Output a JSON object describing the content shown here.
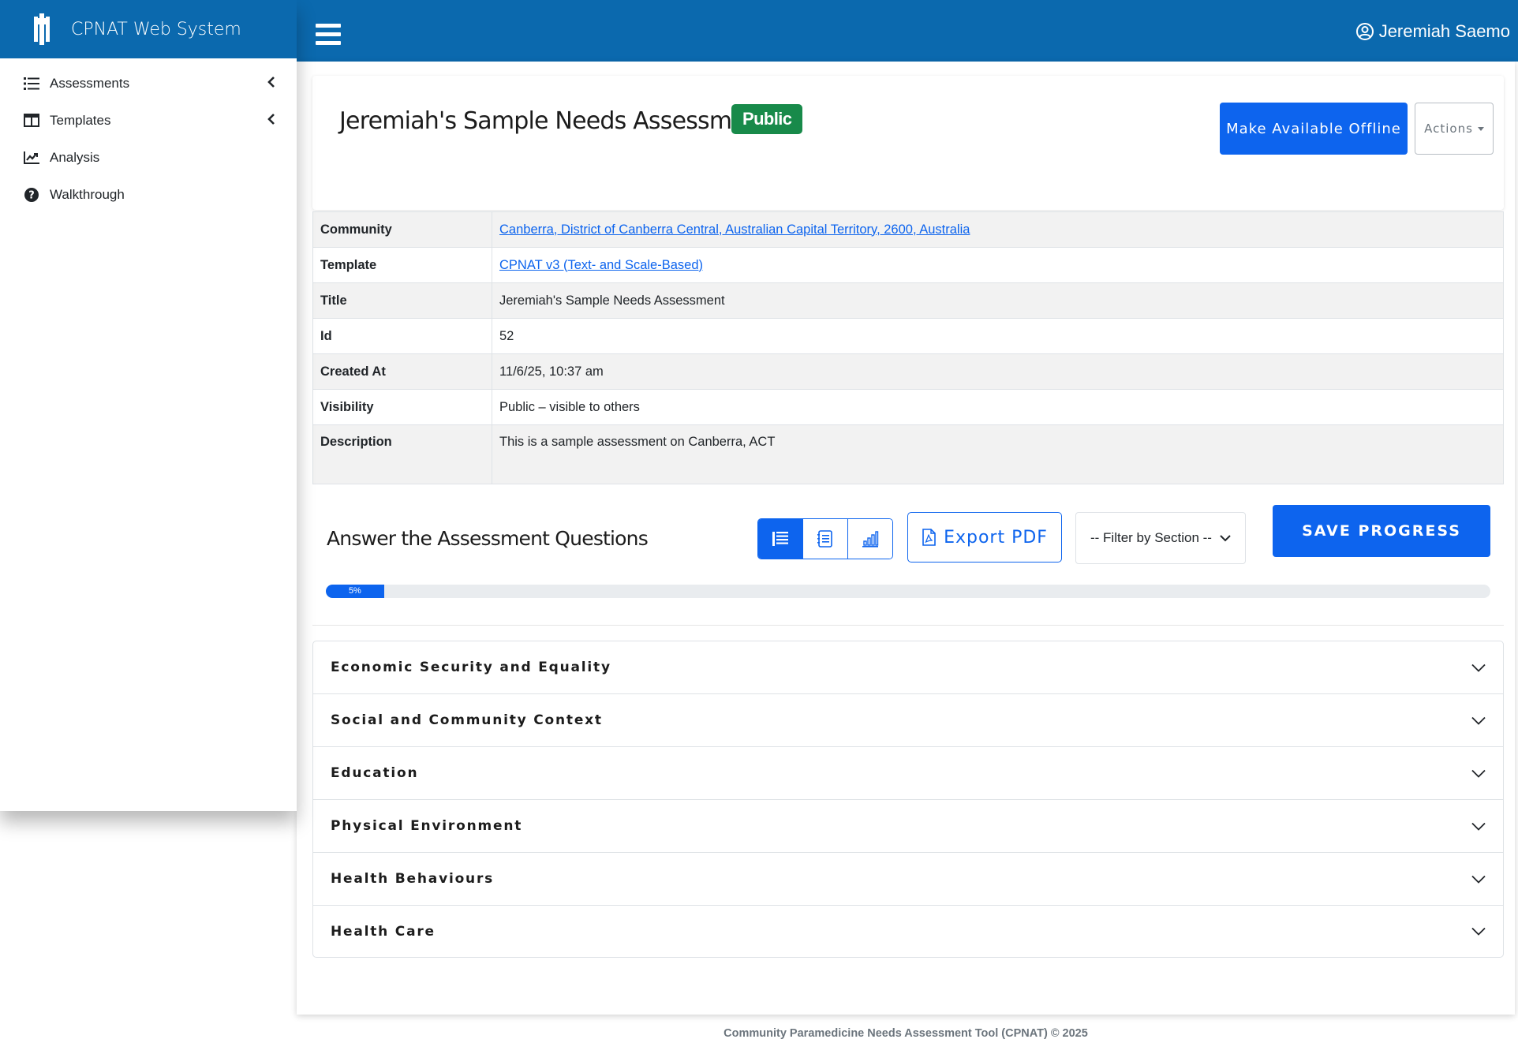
{
  "app": {
    "brand": "CPNAT Web System",
    "user_name": "Jeremiah Saemo"
  },
  "sidebar": {
    "items": [
      {
        "label": "Assessments",
        "icon": "list-icon",
        "has_chevron": true
      },
      {
        "label": "Templates",
        "icon": "table-columns-icon",
        "has_chevron": true
      },
      {
        "label": "Analysis",
        "icon": "chart-line-icon",
        "has_chevron": false
      },
      {
        "label": "Walkthrough",
        "icon": "question-circle-icon",
        "has_chevron": false
      }
    ]
  },
  "header": {
    "title": "Jeremiah's Sample Needs Assessment",
    "badge": "Public",
    "offline_button": "Make Available Offline",
    "actions_button": "Actions"
  },
  "details": {
    "community_label": "Community",
    "community_value": "Canberra, District of Canberra Central, Australian Capital Territory, 2600, Australia",
    "template_label": "Template",
    "template_value": "CPNAT v3 (Text- and Scale-Based)",
    "title_label": "Title",
    "title_value": "Jeremiah's Sample Needs Assessment",
    "id_label": "Id",
    "id_value": "52",
    "created_label": "Created At",
    "created_value": "11/6/25, 10:37 am",
    "visibility_label": "Visibility",
    "visibility_value": "Public – visible to others",
    "description_label": "Description",
    "description_value": "This is a sample assessment on Canberra, ACT"
  },
  "questions": {
    "title": "Answer the Assessment Questions",
    "export_label": "Export PDF",
    "filter_label": "-- Filter by Section --",
    "save_label": "SAVE PROGRESS",
    "progress_text": "5%",
    "progress_percent": 5,
    "sections": [
      "Economic Security and Equality",
      "Social and Community Context",
      "Education",
      "Physical Environment",
      "Health Behaviours",
      "Health Care"
    ]
  },
  "footer": {
    "text": "Community Paramedicine Needs Assessment Tool (CPNAT) © 2025"
  },
  "colors": {
    "brand_blue": "#0b69ae",
    "primary": "#0d64ee",
    "badge_green": "#188a4a"
  }
}
